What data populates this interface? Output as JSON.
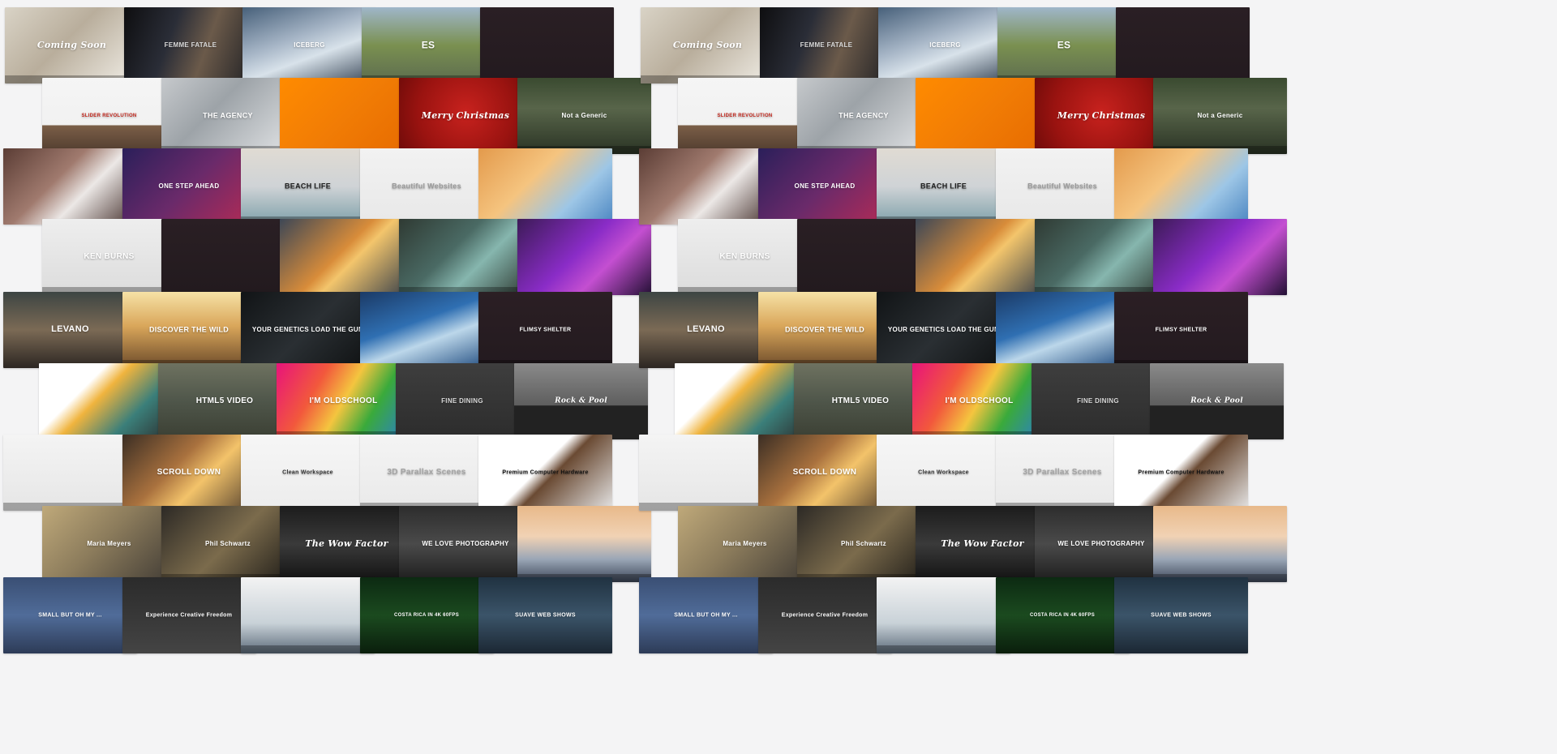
{
  "tiles": [
    {
      "label": "Coming Soon",
      "bg": "linear-gradient(135deg,#d9d3c6 0%,#b9ae9c 45%,#f2efe8 100%)",
      "color": "#ffffff",
      "size": 11,
      "font": "italic"
    },
    {
      "label": "FEMME FATALE",
      "bg": "linear-gradient(110deg,#0e0e10 0%,#2a2d37 35%,#6b5a4a 60%,#1b1d22 100%)",
      "color": "#d9d9d9",
      "size": 8,
      "font": "normal"
    },
    {
      "label": "ICEBERG",
      "bg": "linear-gradient(160deg,#47607a 0%,#a6b5c6 40%,#d8e2ea 60%,#2e3c4d 100%)",
      "color": "#ffffff",
      "size": 8,
      "font": "normal"
    },
    {
      "label": "ES",
      "bg": "linear-gradient(180deg,#9fb6c9 0%,#7a9050 50%,#5c6b4f 100%)",
      "color": "#ffffff",
      "size": 12,
      "font": "normal"
    },
    {
      "label": "",
      "bg": "linear-gradient(180deg,#2a1f24 0%,#231a1f 100%)",
      "color": "#ffffff",
      "size": 8,
      "font": "normal"
    },
    {
      "label": "SLIDER REVOLUTION",
      "bg": "linear-gradient(180deg,#f5f5f5 0%,#f1f1f1 62%,#7b5f48 62%,#4e3a2d 100%)",
      "color": "#c4271d",
      "size": 6,
      "font": "normal"
    },
    {
      "label": "THE AGENCY",
      "bg": "linear-gradient(135deg,#c6c9cc 0%,#9da3a8 40%,#e4e6e8 100%)",
      "color": "#ffffff",
      "size": 9,
      "font": "normal"
    },
    {
      "label": "",
      "bg": "linear-gradient(135deg,#ff8b00 0%,#f17c05 50%,#e66a00 100%)",
      "color": "#ffffff",
      "size": 8,
      "font": "normal"
    },
    {
      "label": "Merry Christmas",
      "bg": "radial-gradient(circle at 50% 45%,#c8221e 0%,#9a1310 60%,#6d0b09 100%)",
      "color": "#ffffff",
      "size": 11,
      "font": "italic"
    },
    {
      "label": "Not a Generic",
      "bg": "linear-gradient(180deg,#3a4a30 0%,#58654a 40%,#2a3324 100%)",
      "color": "#ffffff",
      "size": 8,
      "font": "normal"
    },
    {
      "label": "",
      "bg": "linear-gradient(135deg,#5b3d35 0%,#a07a6e 40%,#ece8e6 60%,#3f2a26 100%)",
      "color": "#ffffff",
      "size": 8,
      "font": "normal"
    },
    {
      "label": "ONE STEP AHEAD",
      "bg": "linear-gradient(135deg,#2b1f5a 0%,#6a2a6a 50%,#b72b54 100%)",
      "color": "#ffffff",
      "size": 8,
      "font": "normal"
    },
    {
      "label": "BEACH LIFE",
      "bg": "linear-gradient(180deg,#e0dbd3 0%,#cfd3d6 50%,#7ea0a9 100%)",
      "color": "#1f1f1f",
      "size": 9,
      "font": "normal"
    },
    {
      "label": "Beautiful Websites",
      "bg": "linear-gradient(180deg,#f2f2f2 0%,#e8e8e8 100%)",
      "color": "#9a9a9a",
      "size": 9,
      "font": "normal"
    },
    {
      "label": "",
      "bg": "linear-gradient(135deg,#e39a4c 0%,#f5c47f 40%,#9dc6e6 70%,#4a85c1 100%)",
      "color": "#ffffff",
      "size": 8,
      "font": "normal"
    },
    {
      "label": "KEN BURNS",
      "bg": "linear-gradient(180deg,#eeeeee 0%,#dcdcdc 100%)",
      "color": "#ffffff",
      "size": 10,
      "font": "normal"
    },
    {
      "label": "",
      "bg": "linear-gradient(180deg,#2a1f24 0%,#221a1e 100%)",
      "color": "#ffffff",
      "size": 8,
      "font": "normal"
    },
    {
      "label": "",
      "bg": "linear-gradient(135deg,#3d4756 0%,#d88c3a 45%,#f3c56c 55%,#2d3848 100%)",
      "color": "#ffffff",
      "size": 8,
      "font": "normal"
    },
    {
      "label": "",
      "bg": "linear-gradient(135deg,#2f3a33 0%,#4a6a64 40%,#86b6ae 60%,#283129 100%)",
      "color": "#ffffff",
      "size": 8,
      "font": "normal"
    },
    {
      "label": "",
      "bg": "linear-gradient(135deg,#3c1b57 0%,#8a2cc7 45%,#c44fd1 65%,#231034 100%)",
      "color": "#ffffff",
      "size": 8,
      "font": "normal"
    },
    {
      "label": "LEVANO",
      "bg": "linear-gradient(180deg,#3d4543 0%,#7b6a55 50%,#2c2622 100%)",
      "color": "#ffffff",
      "size": 11,
      "font": "normal"
    },
    {
      "label": "DISCOVER THE WILD",
      "bg": "linear-gradient(180deg,#f6e2a6 0%,#d9a65a 45%,#6b4a2a 100%)",
      "color": "#ffffff",
      "size": 9,
      "font": "normal"
    },
    {
      "label": "YOUR GENETICS LOAD THE GUN",
      "bg": "linear-gradient(135deg,#111416 0%,#2a2f33 50%,#0d0f10 100%)",
      "color": "#ffffff",
      "size": 8,
      "font": "normal"
    },
    {
      "label": "",
      "bg": "linear-gradient(160deg,#1b3a66 0%,#2f6fb2 40%,#bcd7ea 60%,#19457a 100%)",
      "color": "#ffffff",
      "size": 8,
      "font": "normal"
    },
    {
      "label": "FLIMSY SHELTER",
      "bg": "linear-gradient(180deg,#2b1f24 0%,#231a1f 100%)",
      "color": "#ffffff",
      "size": 7,
      "font": "normal"
    },
    {
      "label": "",
      "bg": "linear-gradient(135deg,#ffffff 0%,#ffffff 33%,#f0b43e 45%,#3b7f7a 70%,#2b2b2b 100%)",
      "color": "#ffffff",
      "size": 8,
      "font": "normal"
    },
    {
      "label": "HTML5 VIDEO",
      "bg": "linear-gradient(180deg,#6e7260 0%,#4f564a 50%,#3b3f33 100%)",
      "color": "#ffffff",
      "size": 10,
      "font": "normal"
    },
    {
      "label": "I'M OLDSCHOOL",
      "bg": "linear-gradient(120deg,#e8137b 0%,#f2583c 30%,#f4c53f 50%,#3aaa3b 70%,#2a7ad7 100%)",
      "color": "#ffffff",
      "size": 10,
      "font": "normal"
    },
    {
      "label": "FINE DINING",
      "bg": "linear-gradient(180deg,#3e3e3e 0%,#2c2c2c 100%)",
      "color": "#d8d8d8",
      "size": 8,
      "font": "normal"
    },
    {
      "label": "Rock & Pool",
      "bg": "linear-gradient(180deg,#8a8a8a 0%,#5e5e5e 55%,#222222 56%,#222222 100%)",
      "color": "#ffffff",
      "size": 9,
      "font": "italic"
    },
    {
      "label": "",
      "bg": "linear-gradient(180deg,#f4f4f4 0%,#e6e6e6 100%)",
      "color": "#333333",
      "size": 8,
      "font": "normal"
    },
    {
      "label": "SCROLL DOWN",
      "bg": "linear-gradient(135deg,#3b2e24 0%,#a9713e 40%,#f3c36a 60%,#4d3b2c 100%)",
      "color": "#ffffff",
      "size": 10,
      "font": "normal"
    },
    {
      "label": "Clean Workspace",
      "bg": "linear-gradient(180deg,#f6f6f6 0%,#ececec 100%)",
      "color": "#333333",
      "size": 7,
      "font": "normal"
    },
    {
      "label": "3D Parallax Scenes",
      "bg": "linear-gradient(180deg,#f4f4f4 0%,#e9e9e9 100%)",
      "color": "#a3a3a3",
      "size": 10,
      "font": "normal"
    },
    {
      "label": "Premium Computer Hardware",
      "bg": "linear-gradient(135deg,#ffffff 0%,#ffffff 45%,#6a4a33 55%,#e6e6e6 100%)",
      "color": "#111111",
      "size": 7,
      "font": "normal"
    },
    {
      "label": "Maria Meyers",
      "bg": "linear-gradient(135deg,#bfa97a 0%,#8c7c5c 45%,#3f3a34 100%)",
      "color": "#ffffff",
      "size": 8,
      "font": "normal"
    },
    {
      "label": "Phil Schwartz",
      "bg": "linear-gradient(135deg,#2c2925 0%,#7b6b4c 50%,#1b1916 100%)",
      "color": "#ffffff",
      "size": 8,
      "font": "normal"
    },
    {
      "label": "The Wow Factor",
      "bg": "linear-gradient(180deg,#1c1c1c 0%,#3a3a3a 50%,#111111 100%)",
      "color": "#ffffff",
      "size": 11,
      "font": "italic"
    },
    {
      "label": "WE LOVE PHOTOGRAPHY",
      "bg": "linear-gradient(180deg,#2d2d2d 0%,#4a4a4a 50%,#1c1c1c 100%)",
      "color": "#ffffff",
      "size": 8,
      "font": "normal"
    },
    {
      "label": "",
      "bg": "linear-gradient(180deg,#e8b98a 0%,#f1d2b4 40%,#9aa6b6 70%,#3c4658 100%)",
      "color": "#ffffff",
      "size": 8,
      "font": "normal"
    },
    {
      "label": "SMALL BUT OH MY ...",
      "bg": "linear-gradient(180deg,#3a4f74 0%,#506c99 50%,#2d3b57 100%)",
      "color": "#ffffff",
      "size": 7,
      "font": "normal"
    },
    {
      "label": "Experience Creative Freedom",
      "bg": "linear-gradient(180deg,#2b2b2b 0%,#444444 100%)",
      "color": "#ffffff",
      "size": 7,
      "font": "normal"
    },
    {
      "label": "",
      "bg": "linear-gradient(180deg,#f3f3f3 0%,#c9d2d8 60%,#5c6b7a 100%)",
      "color": "#ffffff",
      "size": 8,
      "font": "normal"
    },
    {
      "label": "COSTA RICA IN 4K 60FPS",
      "bg": "linear-gradient(180deg,#0c2a12 0%,#1b4a1f 50%,#0a1e0c 100%)",
      "color": "#ffffff",
      "size": 6,
      "font": "normal"
    },
    {
      "label": "SUAVE WEB SHOWS",
      "bg": "linear-gradient(180deg,#203241 0%,#3b5469 50%,#1b2733 100%)",
      "color": "#ffffff",
      "size": 7,
      "font": "normal"
    }
  ]
}
